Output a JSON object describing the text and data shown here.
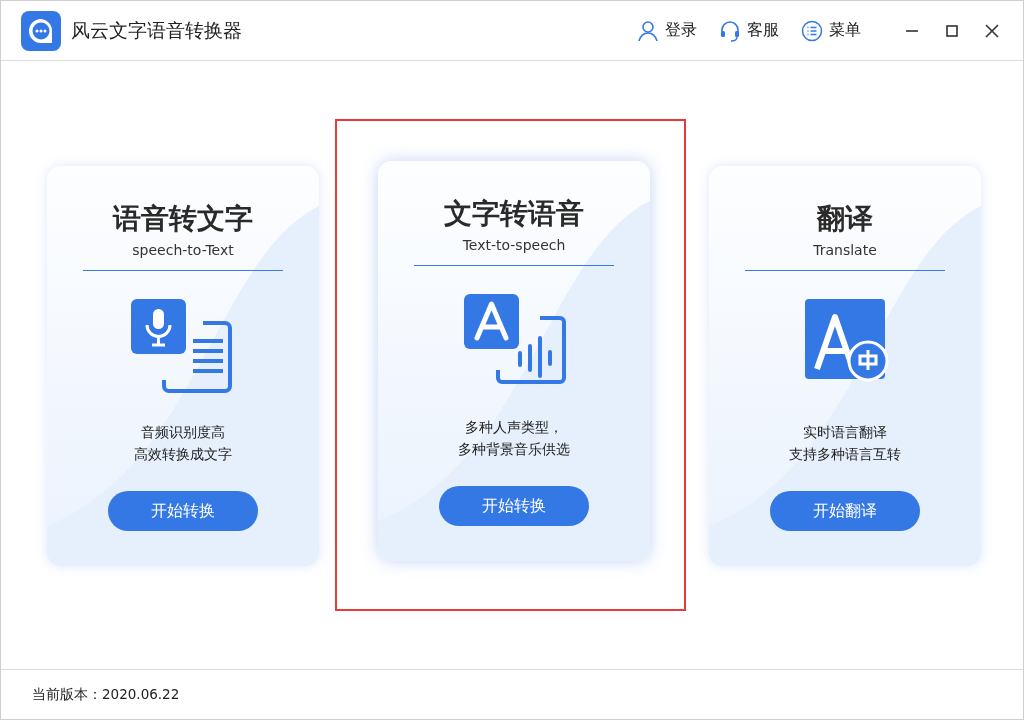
{
  "window": {
    "title": "风云文字语音转换器"
  },
  "header_actions": [
    {
      "kind": "user",
      "label": "登录"
    },
    {
      "kind": "headset",
      "label": "客服"
    },
    {
      "kind": "menu",
      "label": "菜单"
    }
  ],
  "cards": [
    {
      "kind": "speech_to_text",
      "title": "语音转文字",
      "subtitle": "speech-to-Text",
      "lines": [
        "音频识别度高",
        "高效转换成文字"
      ],
      "button": "开始转换",
      "selected": false,
      "highlighted": false
    },
    {
      "kind": "text_to_speech",
      "title": "文字转语音",
      "subtitle": "Text-to-speech",
      "lines": [
        "多种人声类型，",
        "多种背景音乐供选"
      ],
      "button": "开始转换",
      "selected": true,
      "highlighted": true
    },
    {
      "kind": "translate",
      "title": "翻译",
      "subtitle": "Translate",
      "lines": [
        "实时语言翻译",
        "支持多种语言互转"
      ],
      "button": "开始翻译",
      "selected": false,
      "highlighted": false
    }
  ],
  "status_bar": {
    "version": "当前版本：2020.06.22"
  }
}
